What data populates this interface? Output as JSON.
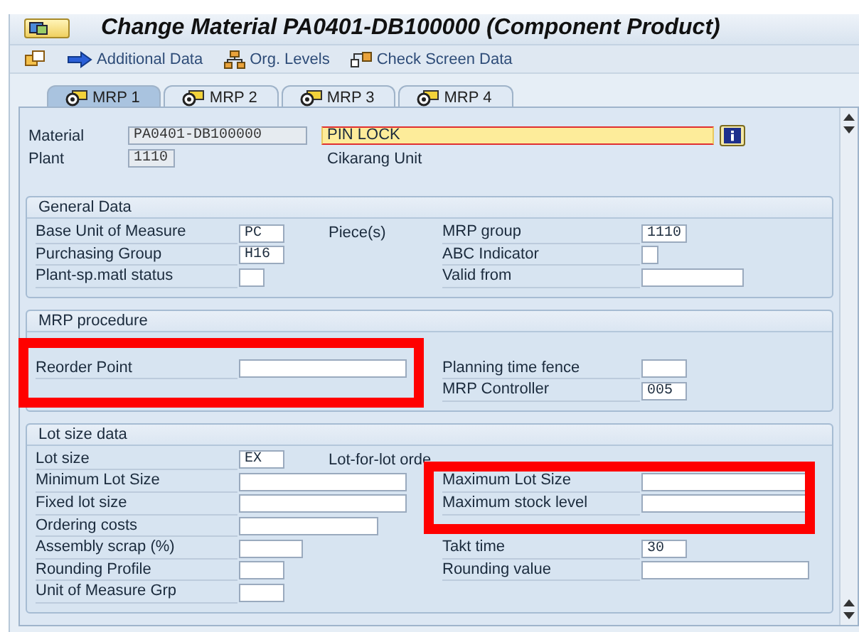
{
  "window": {
    "title": "Change Material PA0401-DB100000 (Component Product)"
  },
  "toolbar": [
    {
      "kind": "views"
    },
    {
      "kind": "arrow",
      "label": "Additional Data"
    },
    {
      "kind": "org",
      "label": "Org. Levels"
    },
    {
      "kind": "check",
      "label": "Check Screen Data"
    }
  ],
  "tabs": [
    {
      "label": "MRP 1",
      "selected": true
    },
    {
      "label": "MRP 2",
      "selected": false
    },
    {
      "label": "MRP 3",
      "selected": false
    },
    {
      "label": "MRP 4",
      "selected": false
    }
  ],
  "header": {
    "material_label": "Material",
    "material": "PA0401-DB100000",
    "description": "PIN LOCK",
    "plant_label": "Plant",
    "plant": "1110",
    "plant_name": "Cikarang Unit"
  },
  "groups": [
    {
      "title": "General Data",
      "rows": [
        {
          "left": {
            "label": "Base Unit of Measure",
            "field": {
              "kind": "code",
              "value": "PC"
            },
            "note": "Piece(s)"
          },
          "right": {
            "label": "MRP group",
            "field": {
              "kind": "code",
              "value": "1110"
            }
          }
        },
        {
          "left": {
            "label": "Purchasing Group",
            "field": {
              "kind": "code",
              "value": "H16"
            }
          },
          "right": {
            "label": "ABC Indicator",
            "field": {
              "kind": "indicator"
            }
          }
        },
        {
          "left": {
            "label": "Plant-sp.matl status",
            "field": {
              "kind": "flag"
            }
          },
          "right": {
            "label": "Valid from",
            "field": {
              "kind": "date"
            }
          }
        }
      ]
    },
    {
      "title": "MRP procedure",
      "rows": [
        {
          "marked_left": true
        },
        {
          "marked_left": true,
          "left": {
            "label": "Reorder Point",
            "field": {
              "kind": "quantity"
            }
          },
          "right": {
            "label": "Planning time fence",
            "field": {
              "kind": "code"
            }
          }
        },
        {
          "marked_left": true,
          "right": {
            "label": "MRP Controller",
            "field": {
              "kind": "code",
              "value": "005"
            }
          }
        }
      ]
    },
    {
      "title": "Lot size data",
      "rows": [
        {
          "left": {
            "label": "Lot size",
            "field": {
              "kind": "code",
              "value": "EX"
            },
            "note": "Lot-for-lot orde"
          }
        },
        {
          "marked_right": true,
          "left": {
            "label": "Minimum Lot Size",
            "field": {
              "kind": "quantity"
            }
          },
          "right": {
            "label": "Maximum Lot Size",
            "field": {
              "kind": "quantity"
            }
          }
        },
        {
          "marked_right": true,
          "left": {
            "label": "Fixed lot size",
            "field": {
              "kind": "quantity"
            }
          },
          "right": {
            "label": "Maximum stock level",
            "field": {
              "kind": "quantity"
            }
          }
        },
        {
          "marked_right": true,
          "left": {
            "label": "Ordering costs",
            "field": {
              "kind": "amount"
            }
          }
        },
        {
          "left": {
            "label": "Assembly scrap (%)",
            "field": {
              "kind": "percent"
            }
          },
          "right": {
            "label": "Takt time",
            "field": {
              "kind": "code",
              "value": "30"
            }
          }
        },
        {
          "left": {
            "label": "Rounding Profile",
            "field": {
              "kind": "code"
            }
          },
          "right": {
            "label": "Rounding value",
            "field": {
              "kind": "quantity"
            }
          }
        },
        {
          "left": {
            "label": "Unit of Measure Grp",
            "field": {
              "kind": "code"
            }
          }
        }
      ]
    }
  ]
}
